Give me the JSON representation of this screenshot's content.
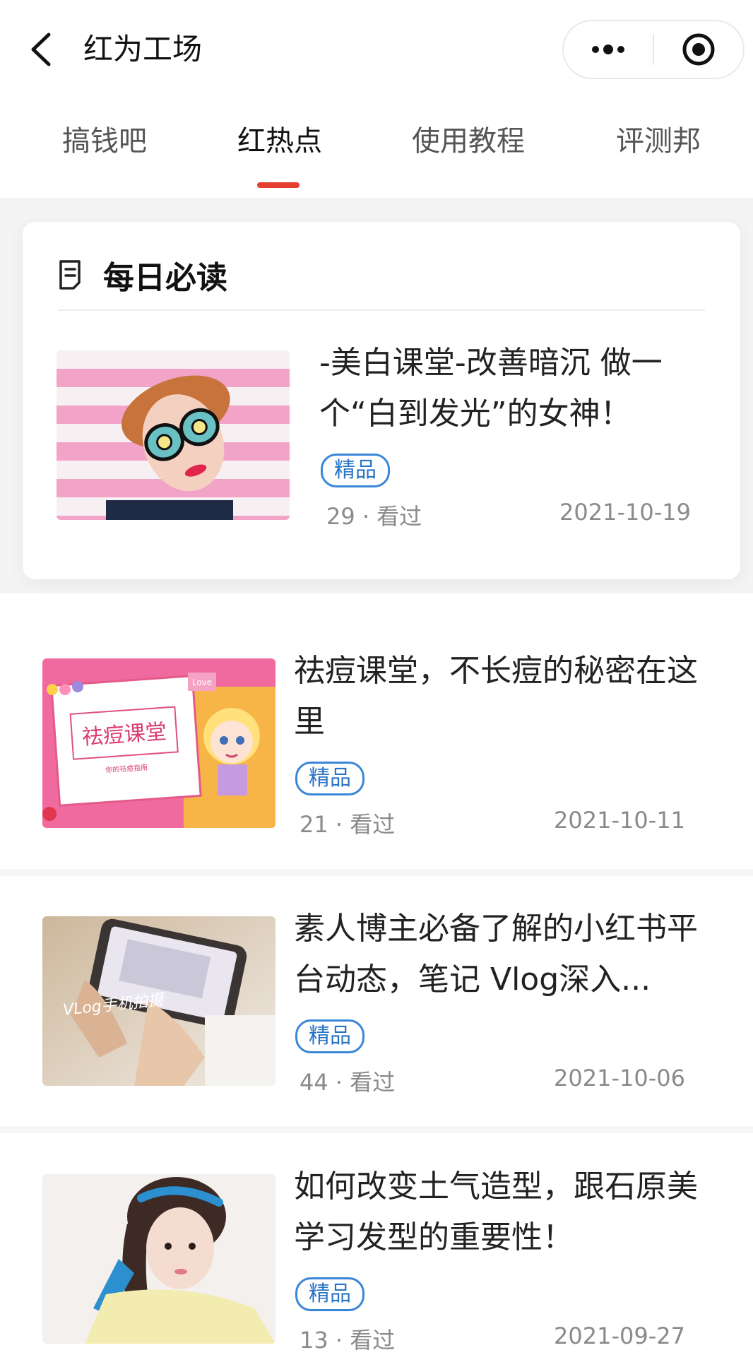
{
  "header": {
    "title": "红为工场",
    "back_icon": "chevron-left-icon",
    "more_icon": "more-dots-icon",
    "close_icon": "target-close-icon"
  },
  "tabs": [
    {
      "label": "搞钱吧",
      "active": false
    },
    {
      "label": "红热点",
      "active": true
    },
    {
      "label": "使用教程",
      "active": false
    },
    {
      "label": "评测邦",
      "active": false
    }
  ],
  "featured": {
    "section_title": "每日必读",
    "section_icon": "document-icon",
    "article": {
      "title": "-美白课堂-改善暗沉 做一个“白到发光”的女神！",
      "badge": "精品",
      "views": "29 · 看过",
      "date": "2021-10-19"
    }
  },
  "articles": [
    {
      "title": "祛痘课堂，不长痘的秘密在这里",
      "badge": "精品",
      "views": "21 · 看过",
      "date": "2021-10-11",
      "thumb_text": "祛痘课堂",
      "thumb_subtext": "你的祛痘指南",
      "thumb_love": "Love"
    },
    {
      "title": "素人博主必备了解的小红书平台动态，笔记 Vlog深入...",
      "badge": "精品",
      "views": "44 · 看过",
      "date": "2021-10-06",
      "thumb_text": "VLog手机拍摄"
    },
    {
      "title": "如何改变土气造型，跟石原美学习发型的重要性！",
      "badge": "精品",
      "views": "13 · 看过",
      "date": "2021-09-27"
    }
  ],
  "colors": {
    "accent": "#e53e2f",
    "badge_blue": "#3a86d6",
    "meta_gray": "#8a8a8a"
  }
}
